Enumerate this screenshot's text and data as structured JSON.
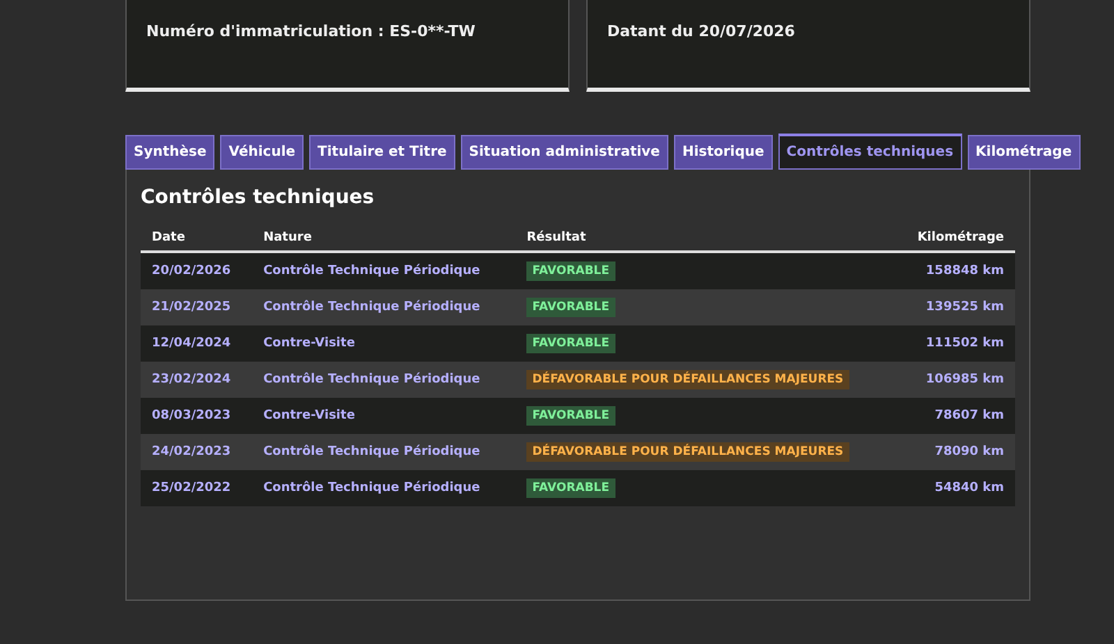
{
  "cards": [
    {
      "text": "Numéro d'immatriculation : ES-0**-TW"
    },
    {
      "text": "Datant du 20/07/2026"
    }
  ],
  "tabs": [
    {
      "label": "Synthèse",
      "selected": false
    },
    {
      "label": "Véhicule",
      "selected": false
    },
    {
      "label": "Titulaire et Titre",
      "selected": false
    },
    {
      "label": "Situation administrative",
      "selected": false
    },
    {
      "label": "Historique",
      "selected": false
    },
    {
      "label": "Contrôles techniques",
      "selected": true
    },
    {
      "label": "Kilométrage",
      "selected": false
    }
  ],
  "panel": {
    "title": "Contrôles techniques",
    "table": {
      "columns": [
        "Date",
        "Nature",
        "Résultat",
        "Kilométrage"
      ],
      "rows": [
        {
          "date": "20/02/2026",
          "nature": "Contrôle Technique Périodique",
          "result": {
            "kind": "favorable",
            "label": "FAVORABLE"
          },
          "km": "158848 km"
        },
        {
          "date": "21/02/2025",
          "nature": "Contrôle Technique Périodique",
          "result": {
            "kind": "favorable",
            "label": "FAVORABLE"
          },
          "km": "139525 km"
        },
        {
          "date": "12/04/2024",
          "nature": "Contre-Visite",
          "result": {
            "kind": "favorable",
            "label": "FAVORABLE"
          },
          "km": "111502 km"
        },
        {
          "date": "23/02/2024",
          "nature": "Contrôle Technique Périodique",
          "result": {
            "kind": "defavorable",
            "label": "DÉFAVORABLE POUR DÉFAILLANCES MAJEURES"
          },
          "km": "106985 km"
        },
        {
          "date": "08/03/2023",
          "nature": "Contre-Visite",
          "result": {
            "kind": "favorable",
            "label": "FAVORABLE"
          },
          "km": "78607 km"
        },
        {
          "date": "24/02/2023",
          "nature": "Contrôle Technique Périodique",
          "result": {
            "kind": "defavorable",
            "label": "DÉFAVORABLE POUR DÉFAILLANCES MAJEURES"
          },
          "km": "78090 km"
        },
        {
          "date": "25/02/2022",
          "nature": "Contrôle Technique Périodique",
          "result": {
            "kind": "favorable",
            "label": "FAVORABLE"
          },
          "km": "54840 km"
        }
      ]
    }
  }
}
